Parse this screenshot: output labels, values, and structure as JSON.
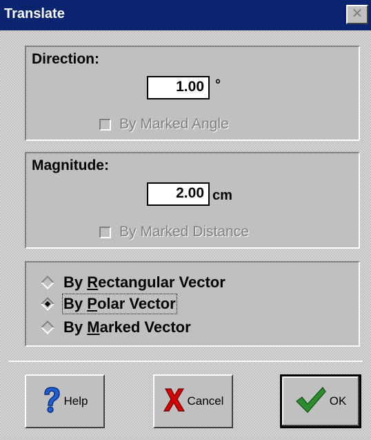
{
  "window": {
    "title": "Translate",
    "close_label": "✕"
  },
  "direction": {
    "label": "Direction:",
    "value": "1.00",
    "unit": "°",
    "checkbox_label": "By Marked Angle"
  },
  "magnitude": {
    "label": "Magnitude:",
    "value": "2.00",
    "unit": "cm",
    "checkbox_label": "By Marked Distance"
  },
  "vector_options": {
    "rectangular": {
      "pre": "By ",
      "mnemonic": "R",
      "post": "ectangular Vector",
      "selected": false
    },
    "polar": {
      "pre": "By ",
      "mnemonic": "P",
      "post": "olar Vector",
      "selected": true
    },
    "marked": {
      "pre": "By ",
      "mnemonic": "M",
      "post": "arked Vector",
      "selected": false
    }
  },
  "buttons": {
    "help": "Help",
    "cancel": "Cancel",
    "ok": "OK"
  },
  "colors": {
    "titlebar": "#0a2470",
    "face": "#c0c0c0",
    "help_icon": "#1f5fd1",
    "cancel_icon": "#d40000",
    "ok_icon": "#2e8b2e"
  }
}
